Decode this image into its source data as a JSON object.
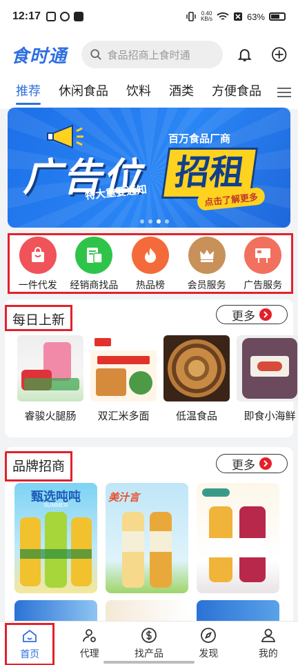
{
  "status": {
    "time": "12:17",
    "speed_top": "0.40",
    "speed_unit": "KB/s",
    "battery": "63%"
  },
  "header": {
    "logo": "食时通",
    "search_placeholder": "食品招商上食时通"
  },
  "tabs": [
    "推荐",
    "休闲食品",
    "饮料",
    "酒类",
    "方便食品"
  ],
  "banner": {
    "subtitle": "百万食品厂商",
    "main_text": "广告位",
    "highlight": "招租",
    "tagline": "特大重要通知",
    "cta": "点击了解更多",
    "active_dot": 3
  },
  "quick_links": [
    {
      "label": "一件代发",
      "icon": "shopping-bag-icon",
      "color": "#f0535a"
    },
    {
      "label": "经销商找品",
      "icon": "distributor-icon",
      "color": "#2ec44a"
    },
    {
      "label": "热品榜",
      "icon": "flame-icon",
      "color": "#f56a3a"
    },
    {
      "label": "会员服务",
      "icon": "crown-icon",
      "color": "#c8915a"
    },
    {
      "label": "广告服务",
      "icon": "billboard-icon",
      "color": "#f2705e"
    }
  ],
  "daily": {
    "title": "每日上新",
    "more": "更多",
    "items": [
      {
        "name": "睿骏火腿肠"
      },
      {
        "name": "双汇米多面"
      },
      {
        "name": "低温食品"
      },
      {
        "name": "即食小海鲜"
      }
    ]
  },
  "brand": {
    "title": "品牌招商",
    "more": "更多",
    "items": [
      {
        "heading": "甄选吨吨",
        "heading_sub": "SUMMER"
      },
      {
        "heading": "美汁言"
      },
      {
        "heading": ""
      }
    ]
  },
  "tabbar": [
    {
      "label": "首页",
      "icon": "home-icon",
      "active": true
    },
    {
      "label": "代理",
      "icon": "agent-icon",
      "active": false
    },
    {
      "label": "找产品",
      "icon": "dollar-icon",
      "active": false
    },
    {
      "label": "发现",
      "icon": "compass-icon",
      "active": false
    },
    {
      "label": "我的",
      "icon": "user-icon",
      "active": false
    }
  ],
  "colors": {
    "brand_blue": "#2f6fe0",
    "highlight_red": "#e3202a"
  }
}
